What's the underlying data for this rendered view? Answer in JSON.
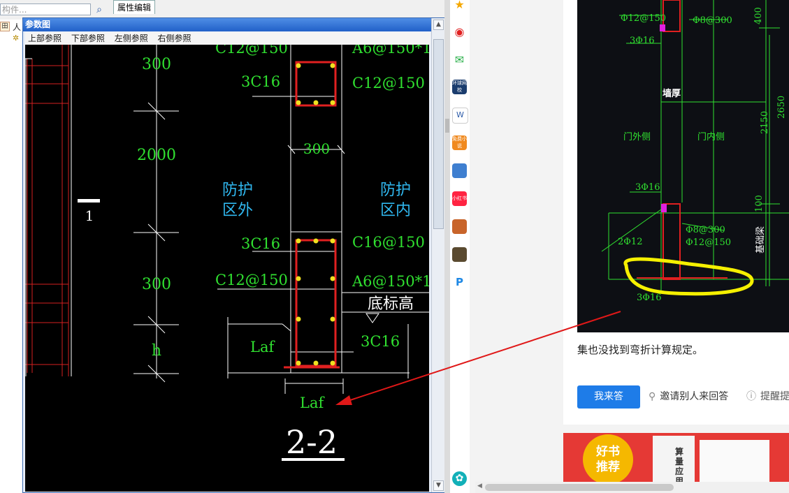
{
  "left_app": {
    "search_placeholder": "构件...",
    "search_icon": "magnifier-icon",
    "prop_tab": "属性编辑",
    "tree_label": "人"
  },
  "dialog": {
    "title": "参数图",
    "menu": [
      "上部参照",
      "下部参照",
      "左侧参照",
      "右侧参照"
    ],
    "drawing": {
      "dims": [
        "300",
        "2000",
        "300",
        "h",
        "300"
      ],
      "marker": "1",
      "zone_outside": [
        "防护",
        "区外"
      ],
      "zone_inside": [
        "防护",
        "区内"
      ],
      "labels_top": [
        "C12@150",
        "A6@150*1",
        "3C16",
        "C12@150"
      ],
      "labels_bottom": [
        "3C16",
        "C16@150",
        "C12@150",
        "A6@150*1",
        "底标高",
        "3C16"
      ],
      "laf": [
        "Laf",
        "Laf"
      ],
      "section": "2-2"
    }
  },
  "browser": {
    "cad": {
      "labels": [
        "Φ12@150",
        "Φ8@300",
        "3Φ16",
        "400",
        "墙厚",
        "门外侧",
        "门内侧",
        "2150",
        "2650",
        "3Φ16",
        "100",
        "Φ8@300",
        "Φ12@150",
        "2Φ12",
        "基础梁",
        "3Φ16"
      ]
    },
    "answer_text": "集也没找到弯折计算规定。",
    "answer_button": "我来答",
    "invite_label": "邀请别人来回答",
    "remind_label": "提醒提",
    "banner_badge": [
      "好书",
      "推荐"
    ],
    "banner_text": [
      "算",
      "量",
      "应",
      "用"
    ]
  },
  "dock": {
    "icons": [
      "star-icon",
      "weibo-icon",
      "mail-icon",
      "huanqiu-icon",
      "word-icon",
      "novel-icon",
      "game-icon",
      "xiaohongshu-icon",
      "game2-icon",
      "game3-icon",
      "pdf-icon",
      "assistant-icon"
    ],
    "icon_texts": [
      "环球网校",
      "免费小说",
      "小红书"
    ]
  }
}
